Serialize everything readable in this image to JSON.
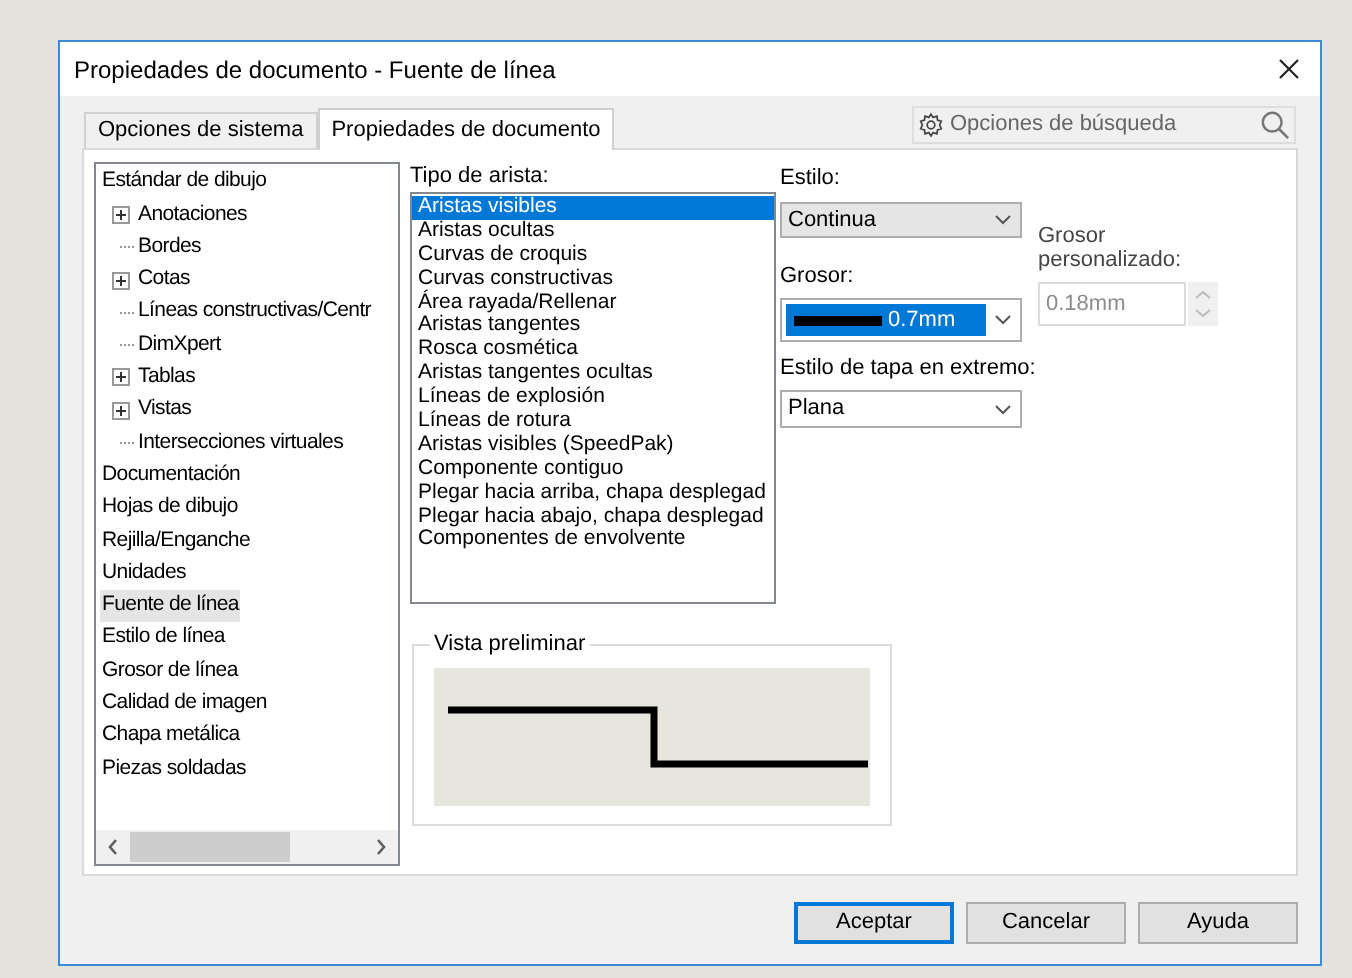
{
  "window": {
    "title": "Propiedades de documento - Fuente de línea"
  },
  "tabs": [
    {
      "label": "Opciones de sistema",
      "selected": false
    },
    {
      "label": "Propiedades de documento",
      "selected": true
    }
  ],
  "search": {
    "placeholder": "Opciones de búsqueda"
  },
  "tree": [
    {
      "label": "Estándar de dibujo",
      "selected": false,
      "children": [
        {
          "label": "Anotaciones",
          "kind": "branch",
          "selected": false
        },
        {
          "label": "Bordes",
          "kind": "leaf",
          "selected": false
        },
        {
          "label": "Cotas",
          "kind": "branch",
          "selected": false
        },
        {
          "label": "Líneas constructivas/Centr",
          "kind": "leaf",
          "selected": false
        },
        {
          "label": "DimXpert",
          "kind": "leaf",
          "selected": false
        },
        {
          "label": "Tablas",
          "kind": "branch",
          "selected": false
        },
        {
          "label": "Vistas",
          "kind": "branch",
          "selected": false
        },
        {
          "label": "Intersecciones virtuales",
          "kind": "leaf",
          "selected": false
        }
      ]
    },
    {
      "label": "Documentación",
      "selected": false
    },
    {
      "label": "Hojas de dibujo",
      "selected": false
    },
    {
      "label": "Rejilla/Enganche",
      "selected": false
    },
    {
      "label": "Unidades",
      "selected": false
    },
    {
      "label": "Fuente de línea",
      "selected": true
    },
    {
      "label": "Estilo de línea",
      "selected": false
    },
    {
      "label": "Grosor de línea",
      "selected": false
    },
    {
      "label": "Calidad de imagen",
      "selected": false
    },
    {
      "label": "Chapa metálica",
      "selected": false
    },
    {
      "label": "Piezas soldadas",
      "selected": false
    }
  ],
  "edge_type": {
    "label": "Tipo de arista:",
    "items": [
      {
        "label": "Aristas visibles",
        "selected": true
      },
      {
        "label": "Aristas ocultas",
        "selected": false
      },
      {
        "label": "Curvas de croquis",
        "selected": false
      },
      {
        "label": "Curvas constructivas",
        "selected": false
      },
      {
        "label": "Área rayada/Rellenar",
        "selected": false
      },
      {
        "label": "Aristas tangentes",
        "selected": false
      },
      {
        "label": "Rosca cosmética",
        "selected": false
      },
      {
        "label": "Aristas tangentes ocultas",
        "selected": false
      },
      {
        "label": "Líneas de explosión",
        "selected": false
      },
      {
        "label": "Líneas de rotura",
        "selected": false
      },
      {
        "label": "Aristas visibles (SpeedPak)",
        "selected": false
      },
      {
        "label": "Componente contiguo",
        "selected": false
      },
      {
        "label": "Plegar hacia arriba, chapa desplegad",
        "selected": false
      },
      {
        "label": "Plegar hacia abajo, chapa desplegad",
        "selected": false
      },
      {
        "label": "Componentes de envolvente",
        "selected": false
      }
    ]
  },
  "style": {
    "label": "Estilo:",
    "value": "Continua"
  },
  "thickness": {
    "label": "Grosor:",
    "value": "0.7mm"
  },
  "custom_thickness": {
    "label": "Grosor personalizado:",
    "value": "0.18mm",
    "disabled": true
  },
  "end_cap": {
    "label": "Estilo de tapa en extremo:",
    "value": "Plana"
  },
  "preview": {
    "title": "Vista preliminar"
  },
  "buttons": [
    {
      "label": "Aceptar",
      "default": true
    },
    {
      "label": "Cancelar",
      "default": false
    },
    {
      "label": "Ayuda",
      "default": false
    }
  ]
}
